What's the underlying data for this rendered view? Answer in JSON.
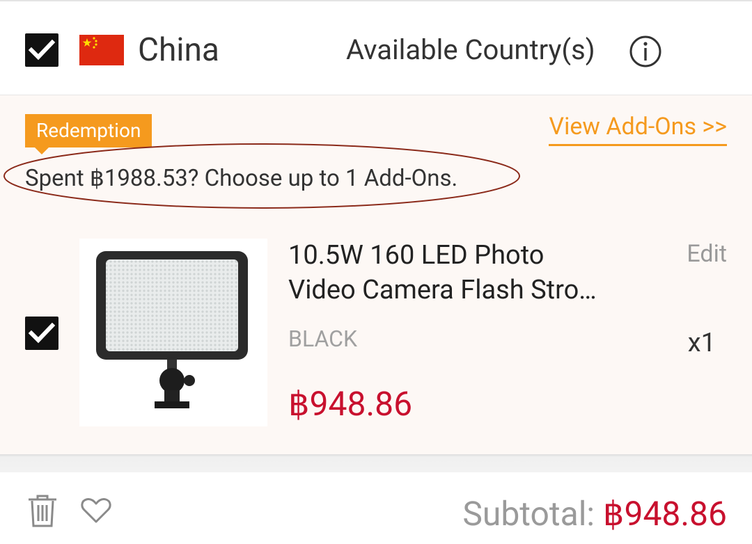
{
  "store": {
    "country_name": "China",
    "available_label": "Available Country(s)",
    "flag": "china-flag"
  },
  "promotion": {
    "tag": "Redemption",
    "view_addons": "View Add-Ons >>",
    "message": "Spent ฿1988.53? Choose up to 1 Add-Ons."
  },
  "item": {
    "title_line1": "10.5W 160 LED Photo",
    "title_line2": "Video Camera Flash Stro…",
    "edit_label": "Edit",
    "variant": "BLACK",
    "quantity": "x1",
    "price": "฿948.86",
    "checked": true
  },
  "footer": {
    "subtotal_label": "Subtotal:",
    "subtotal_value": "฿948.86"
  },
  "colors": {
    "accent_orange": "#f59a1e",
    "price_red": "#c8102e",
    "annotation_ellipse": "#8b2a1a"
  },
  "icons": [
    "checkmark-icon",
    "info-icon",
    "trash-icon",
    "heart-icon"
  ]
}
